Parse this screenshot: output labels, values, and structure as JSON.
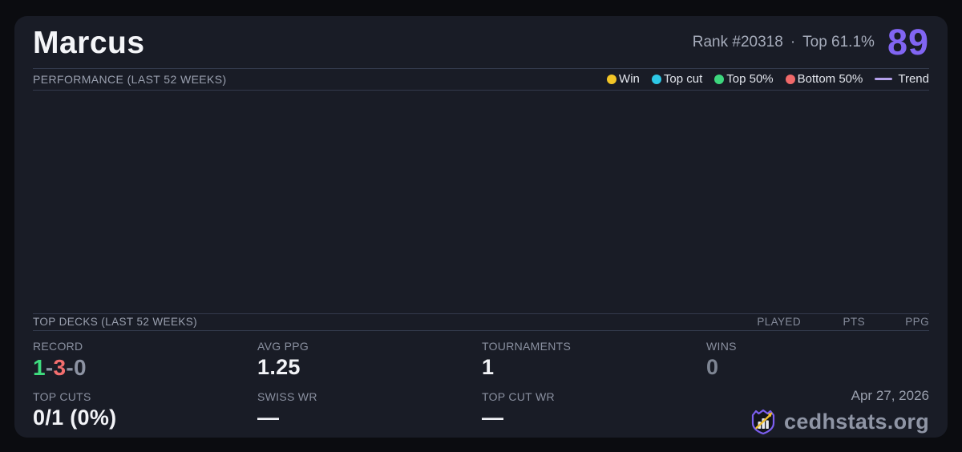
{
  "colors": {
    "accent": "#8165f2",
    "record_win": "#3edc7e",
    "record_loss": "#f26e6e",
    "record_draw": "#8d93a3"
  },
  "header": {
    "title": "Marcus",
    "rank": "Rank #20318",
    "separator": "·",
    "top_percent": "Top 61.1%",
    "score": "89"
  },
  "performance": {
    "section_title": "PERFORMANCE (LAST 52 WEEKS)",
    "legend": [
      {
        "label": "Win",
        "color": "#f2c526"
      },
      {
        "label": "Top cut",
        "color": "#2dc8e6"
      },
      {
        "label": "Top 50%",
        "color": "#3dd67d"
      },
      {
        "label": "Bottom 50%",
        "color": "#f06969"
      }
    ],
    "trend_label": "Trend",
    "trend_color": "#b4a0eb",
    "chart_points": []
  },
  "top_decks": {
    "section_title": "TOP DECKS (LAST 52 WEEKS)",
    "columns": [
      "PLAYED",
      "PTS",
      "PPG"
    ],
    "rows": []
  },
  "stats": {
    "record": {
      "label": "RECORD",
      "wins": "1",
      "losses": "3",
      "draws": "0",
      "separator": "-"
    },
    "avg_ppg": {
      "label": "AVG PPG",
      "value": "1.25"
    },
    "tournaments": {
      "label": "TOURNAMENTS",
      "value": "1"
    },
    "wins": {
      "label": "WINS",
      "value": "0"
    },
    "top_cuts": {
      "label": "TOP CUTS",
      "value": "0/1 (0%)"
    },
    "swiss_wr": {
      "label": "SWISS WR",
      "value": "—"
    },
    "top_cut_wr": {
      "label": "TOP CUT WR",
      "value": "—"
    }
  },
  "footer": {
    "date": "Apr 27, 2026",
    "brand": "cedhstats.org"
  }
}
